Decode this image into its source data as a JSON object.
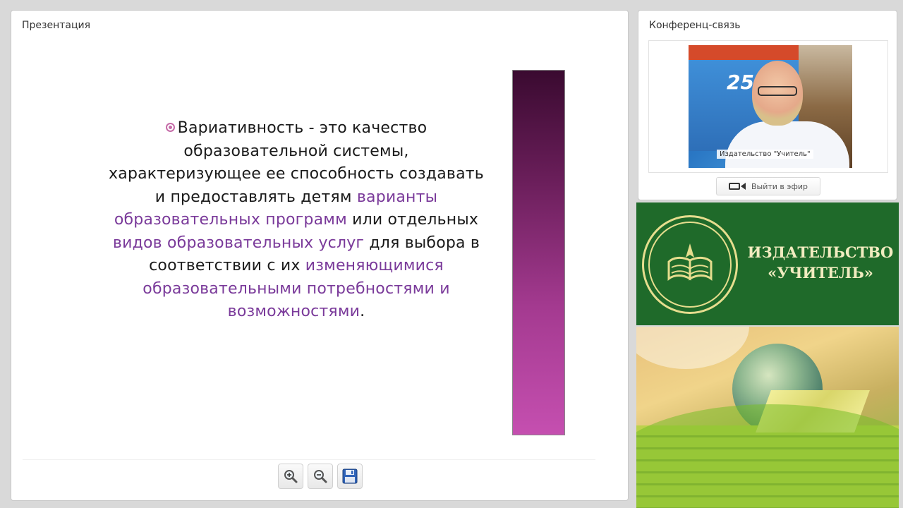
{
  "presentation": {
    "title": "Презентация",
    "slide": {
      "parts": [
        {
          "text": "Вариативность - это качество образовательной системы, характеризующее ее способность создавать и предоставлять детям ",
          "highlight": false
        },
        {
          "text": "варианты образовательных программ",
          "highlight": true
        },
        {
          "text": " или отдельных ",
          "highlight": false
        },
        {
          "text": "видов образовательных услуг",
          "highlight": true
        },
        {
          "text": " для выбора в соответствии с их ",
          "highlight": false
        },
        {
          "text": "изменяющимися образовательными потребностями и возможностями",
          "highlight": true
        },
        {
          "text": ".",
          "highlight": false
        }
      ],
      "accent_color": "#7a3a9a",
      "bullet_color": "#c56ca8"
    },
    "toolbar": {
      "zoom_in_icon": "zoom-in",
      "zoom_out_icon": "zoom-out",
      "save_icon": "floppy-disk"
    }
  },
  "conference": {
    "title": "Конференц-связь",
    "video": {
      "caption": "Издательство \"Учитель\"",
      "banner_number": "25"
    },
    "broadcast_label": "Выйти в эфир"
  },
  "publisher": {
    "line1": "ИЗДАТЕЛЬСТВО",
    "line2": "«УЧИТЕЛЬ»",
    "brand_color": "#1f6a2a"
  }
}
